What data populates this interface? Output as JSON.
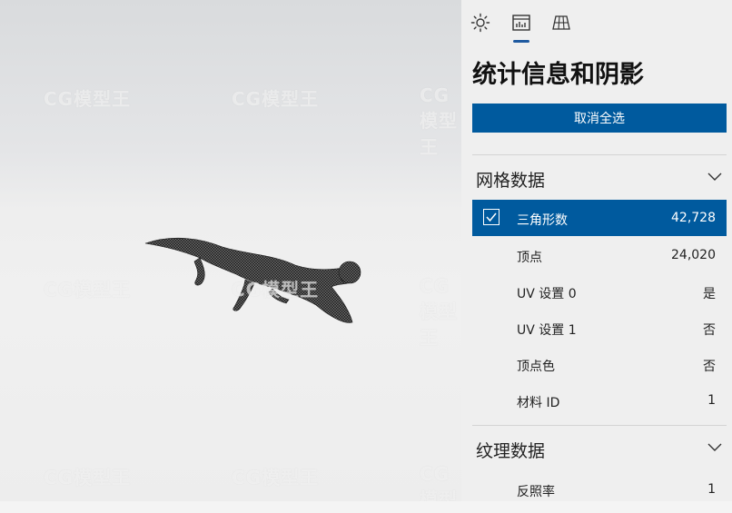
{
  "tabs": [
    {
      "icon": "brightness-icon"
    },
    {
      "icon": "stats-icon",
      "active": true
    },
    {
      "icon": "grid-icon"
    }
  ],
  "panel": {
    "title": "统计信息和阴影",
    "deselect_all": "取消全选"
  },
  "mesh_section": {
    "title": "网格数据",
    "rows": [
      {
        "label": "三角形数",
        "value": "42,728",
        "checked": true
      },
      {
        "label": "顶点",
        "value": "24,020"
      },
      {
        "label": "UV 设置 0",
        "value": "是"
      },
      {
        "label": "UV 设置 1",
        "value": "否"
      },
      {
        "label": "顶点色",
        "value": "否"
      },
      {
        "label": "材料 ID",
        "value": "1"
      }
    ]
  },
  "texture_section": {
    "title": "纹理数据",
    "rows": [
      {
        "label": "反照率",
        "value": "1"
      }
    ]
  },
  "watermark": "CG模型王",
  "colors": {
    "accent": "#005a9e",
    "panel_bg": "#efefef"
  }
}
